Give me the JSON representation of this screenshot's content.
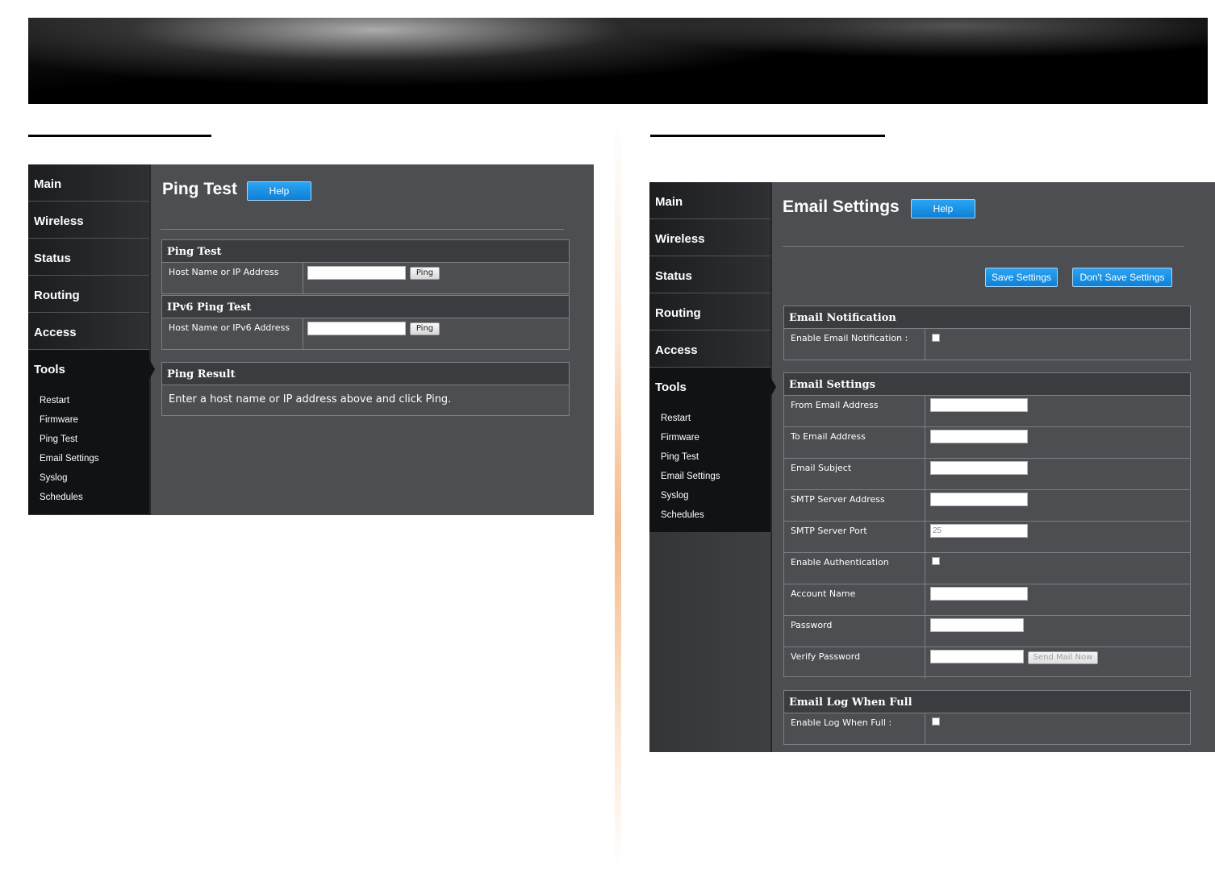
{
  "left_panel": {
    "sidebar": {
      "nav": [
        "Main",
        "Wireless",
        "Status",
        "Routing",
        "Access",
        "Tools"
      ],
      "tools_sub": [
        "Restart",
        "Firmware",
        "Ping Test",
        "Email Settings",
        "Syslog",
        "Schedules"
      ]
    },
    "title": "Ping Test",
    "help": "Help",
    "ping_box": {
      "heading": "Ping Test",
      "label": "Host Name or IP Address",
      "input_value": "",
      "button": "Ping"
    },
    "ipv6_box": {
      "heading": "IPv6 Ping Test",
      "label": "Host Name or IPv6 Address",
      "input_value": "",
      "button": "Ping"
    },
    "result_box": {
      "heading": "Ping Result",
      "text": "Enter a host name or IP address above and click Ping."
    }
  },
  "right_panel": {
    "sidebar": {
      "nav": [
        "Main",
        "Wireless",
        "Status",
        "Routing",
        "Access",
        "Tools"
      ],
      "tools_sub": [
        "Restart",
        "Firmware",
        "Ping Test",
        "Email Settings",
        "Syslog",
        "Schedules"
      ]
    },
    "title": "Email Settings",
    "help": "Help",
    "save": "Save Settings",
    "dont_save": "Don't Save Settings",
    "notification_box": {
      "heading": "Email Notification",
      "label": "Enable Email Notification :",
      "checked": false
    },
    "settings_box": {
      "heading": "Email Settings",
      "from_label": "From Email Address",
      "to_label": "To Email Address",
      "subject_label": "Email Subject",
      "smtp_addr_label": "SMTP Server Address",
      "smtp_port_label": "SMTP Server Port",
      "smtp_port_value": "25",
      "auth_label": "Enable Authentication",
      "account_label": "Account Name",
      "password_label": "Password",
      "verify_label": "Verify Password",
      "send_mail": "Send Mail Now"
    },
    "log_box": {
      "heading": "Email Log When Full",
      "label": "Enable Log When Full :",
      "checked": false
    }
  }
}
